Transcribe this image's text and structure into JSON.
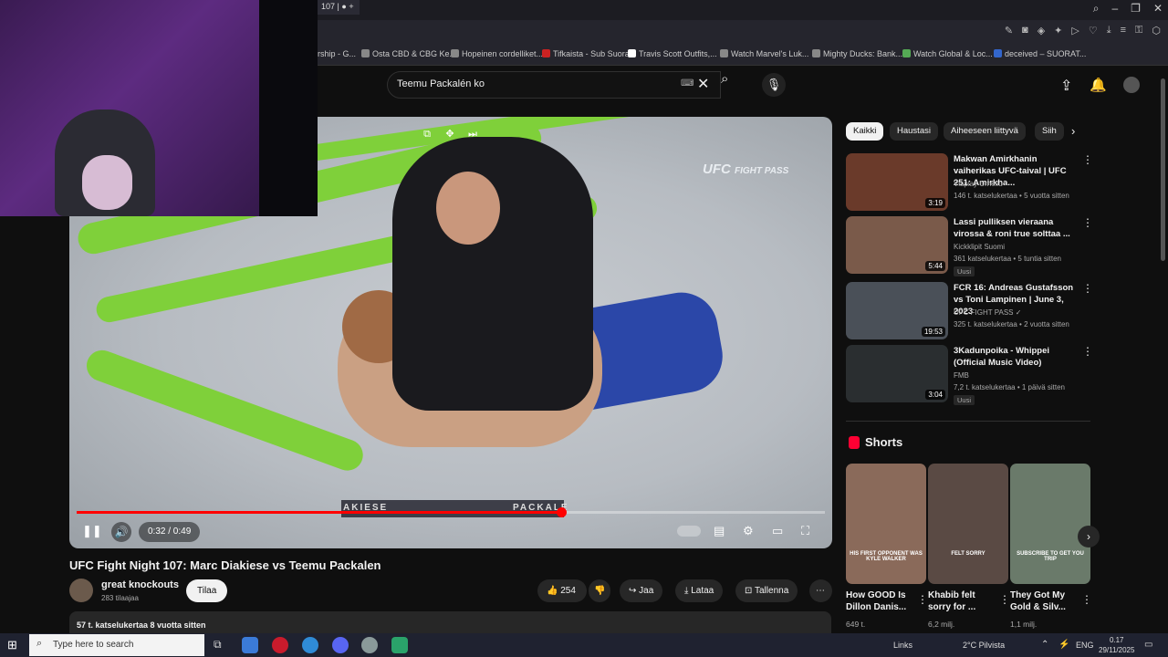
{
  "browser": {
    "tab_title": "107 |",
    "bookmarks": [
      "rship - G...",
      "Osta CBD & CBG Ke...",
      "Hopeinen cordelliket...",
      "Tifkaista - Sub Suora",
      "Travis Scott Outfits,...",
      "Watch Marvel's Luk...",
      "Mighty Ducks: Bank...",
      "Watch Global & Loc...",
      "deceived – SUORAT..."
    ]
  },
  "search": {
    "value": "Teemu Packalén ko"
  },
  "player": {
    "overlay_logo": "UFC",
    "overlay_logo_sub": "FIGHT PASS",
    "time": "0:32 / 0:49",
    "progress": 0.647,
    "banner_left": "AKIESE",
    "banner_right": "PACKALE"
  },
  "video": {
    "title": "UFC Fight Night 107: Marc Diakiese vs Teemu Packalen",
    "channel": "great knockouts",
    "subscribers": "283 tilaajaa",
    "subscribe_label": "Tilaa",
    "likes": "254",
    "share_label": "Jaa",
    "download_label": "Lataa",
    "save_label": "Tallenna",
    "meta": "57 t. katselukertaa  8 vuotta sitten"
  },
  "chips": [
    "Kaikki",
    "Haustasi",
    "Aiheeseen liittyvä",
    "Siih"
  ],
  "recommendations": [
    {
      "title": "Makwan Amirkhanin vaiherikas UFC-taival | UFC 251: Amirkha...",
      "channel": "Viaplay Urheilu",
      "meta": "146 t. katselukertaa • 5 vuotta sitten",
      "duration": "3:19",
      "badge": "",
      "thumb_color": "#6a3a2a"
    },
    {
      "title": "Lassi pulliksen vieraana virossa & roni true solttaa ...",
      "channel": "Kickklipit Suomi",
      "meta": "361 katselukertaa • 5 tuntia sitten",
      "duration": "5:44",
      "badge": "Uusi",
      "thumb_color": "#7a5a4a"
    },
    {
      "title": "FCR 16: Andreas Gustafsson vs Toni Lampinen | June 3, 2023",
      "channel": "UFC FIGHT PASS ✓",
      "meta": "325 t. katselukertaa • 2 vuotta sitten",
      "duration": "19:53",
      "badge": "",
      "thumb_color": "#4a5058"
    },
    {
      "title": "3Kadunpoika - Whippei (Official Music Video)",
      "channel": "FMB",
      "meta": "7,2 t. katselukertaa • 1 päivä sitten",
      "duration": "3:04",
      "badge": "Uusi",
      "thumb_color": "#2a2e30"
    }
  ],
  "shorts": {
    "heading": "Shorts",
    "items": [
      {
        "title": "How GOOD Is Dillon Danis...",
        "views": "649 t.",
        "caption": "HIS FIRST OPPONENT WAS KYLE WALKER",
        "thumb_color": "#8a6a5a"
      },
      {
        "title": "Khabib felt sorry for ...",
        "views": "6,2 milj.",
        "caption": "FELT SORRY",
        "thumb_color": "#5a4a44"
      },
      {
        "title": "They Got My Gold & Silv...",
        "views": "1,1 milj.",
        "caption": "SUBSCRIBE TO GET YOU TRIP",
        "thumb_color": "#6a7a6a"
      }
    ]
  },
  "taskbar": {
    "search_placeholder": "Type here to search",
    "links": "Links",
    "weather": "2°C  Pilvista",
    "lang": "ENG",
    "time": "0.17",
    "date": "29/11/2025"
  }
}
